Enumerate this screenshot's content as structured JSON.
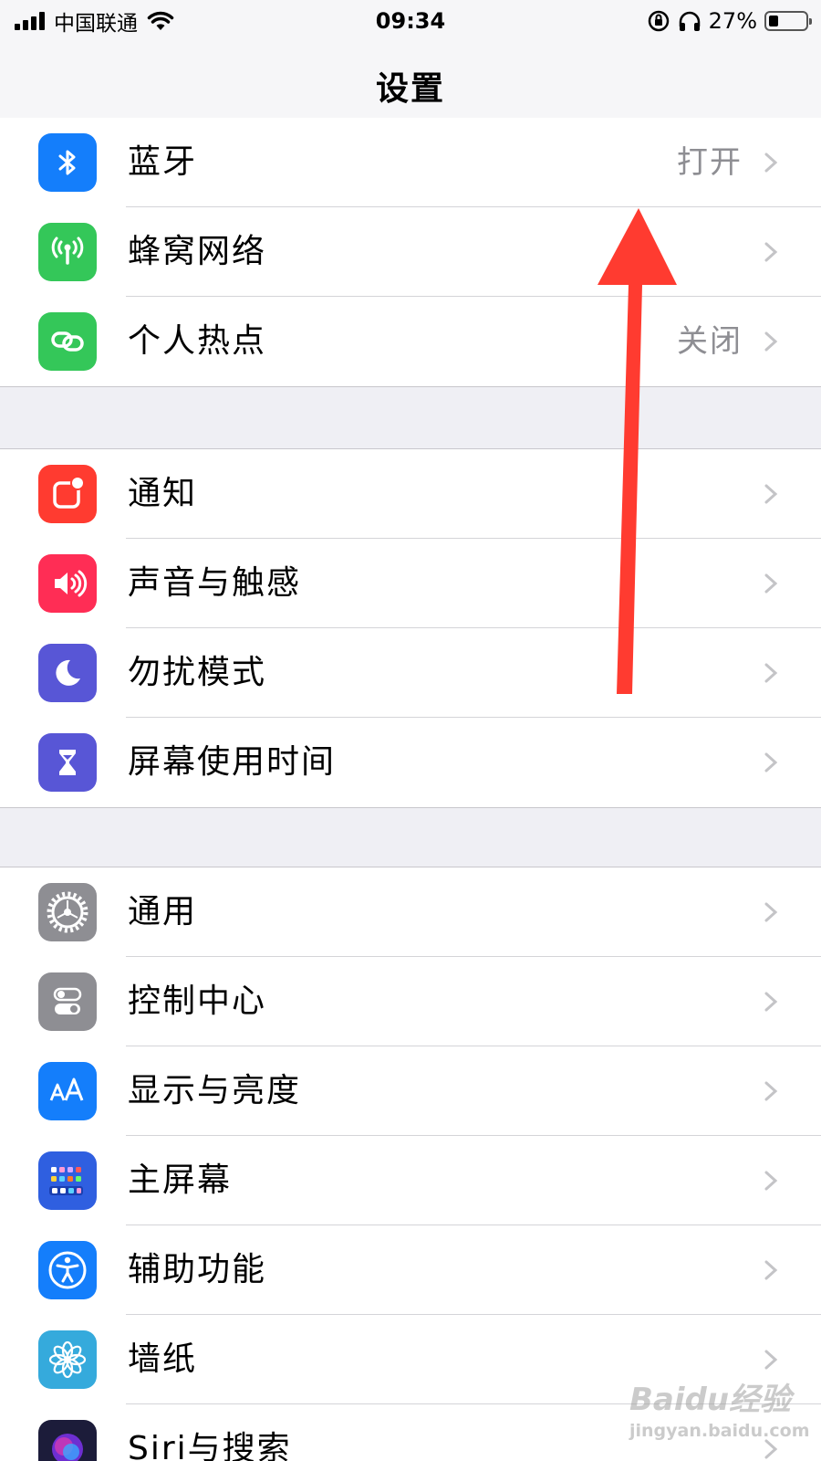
{
  "status_bar": {
    "carrier": "中国联通",
    "time": "09:34",
    "battery_percent_text": "27%",
    "battery_level": 0.27
  },
  "nav": {
    "title": "设置"
  },
  "groups": [
    {
      "items": [
        {
          "label": "蓝牙",
          "value": "打开",
          "icon": "bluetooth-icon",
          "color": "#147efb"
        },
        {
          "label": "蜂窝网络",
          "value": "",
          "icon": "cellular-icon",
          "color": "#34c759"
        },
        {
          "label": "个人热点",
          "value": "关闭",
          "icon": "hotspot-icon",
          "color": "#34c759"
        }
      ]
    },
    {
      "items": [
        {
          "label": "通知",
          "icon": "notifications-icon",
          "color": "#ff3b30"
        },
        {
          "label": "声音与触感",
          "icon": "speaker-icon",
          "color": "#ff2d55"
        },
        {
          "label": "勿扰模式",
          "icon": "moon-icon",
          "color": "#5856d6"
        },
        {
          "label": "屏幕使用时间",
          "icon": "hourglass-icon",
          "color": "#5856d6"
        }
      ]
    },
    {
      "items": [
        {
          "label": "通用",
          "icon": "gear-icon",
          "color": "#8e8e93"
        },
        {
          "label": "控制中心",
          "icon": "toggles-icon",
          "color": "#8e8e93"
        },
        {
          "label": "显示与亮度",
          "icon": "text-size-icon",
          "color": "#147efb"
        },
        {
          "label": "主屏幕",
          "icon": "home-grid-icon",
          "color": "#2f5fe0"
        },
        {
          "label": "辅助功能",
          "icon": "accessibility-icon",
          "color": "#147efb"
        },
        {
          "label": "墙纸",
          "icon": "flower-icon",
          "color": "#35aadc"
        },
        {
          "label": "Siri与搜索",
          "icon": "siri-icon",
          "color": "#1c1c3a"
        }
      ]
    }
  ],
  "annotation": {
    "shape": "red-arrow-up",
    "color": "#ff3b30"
  },
  "watermark": {
    "brand": "Baidu经验",
    "url": "jingyan.baidu.com"
  }
}
